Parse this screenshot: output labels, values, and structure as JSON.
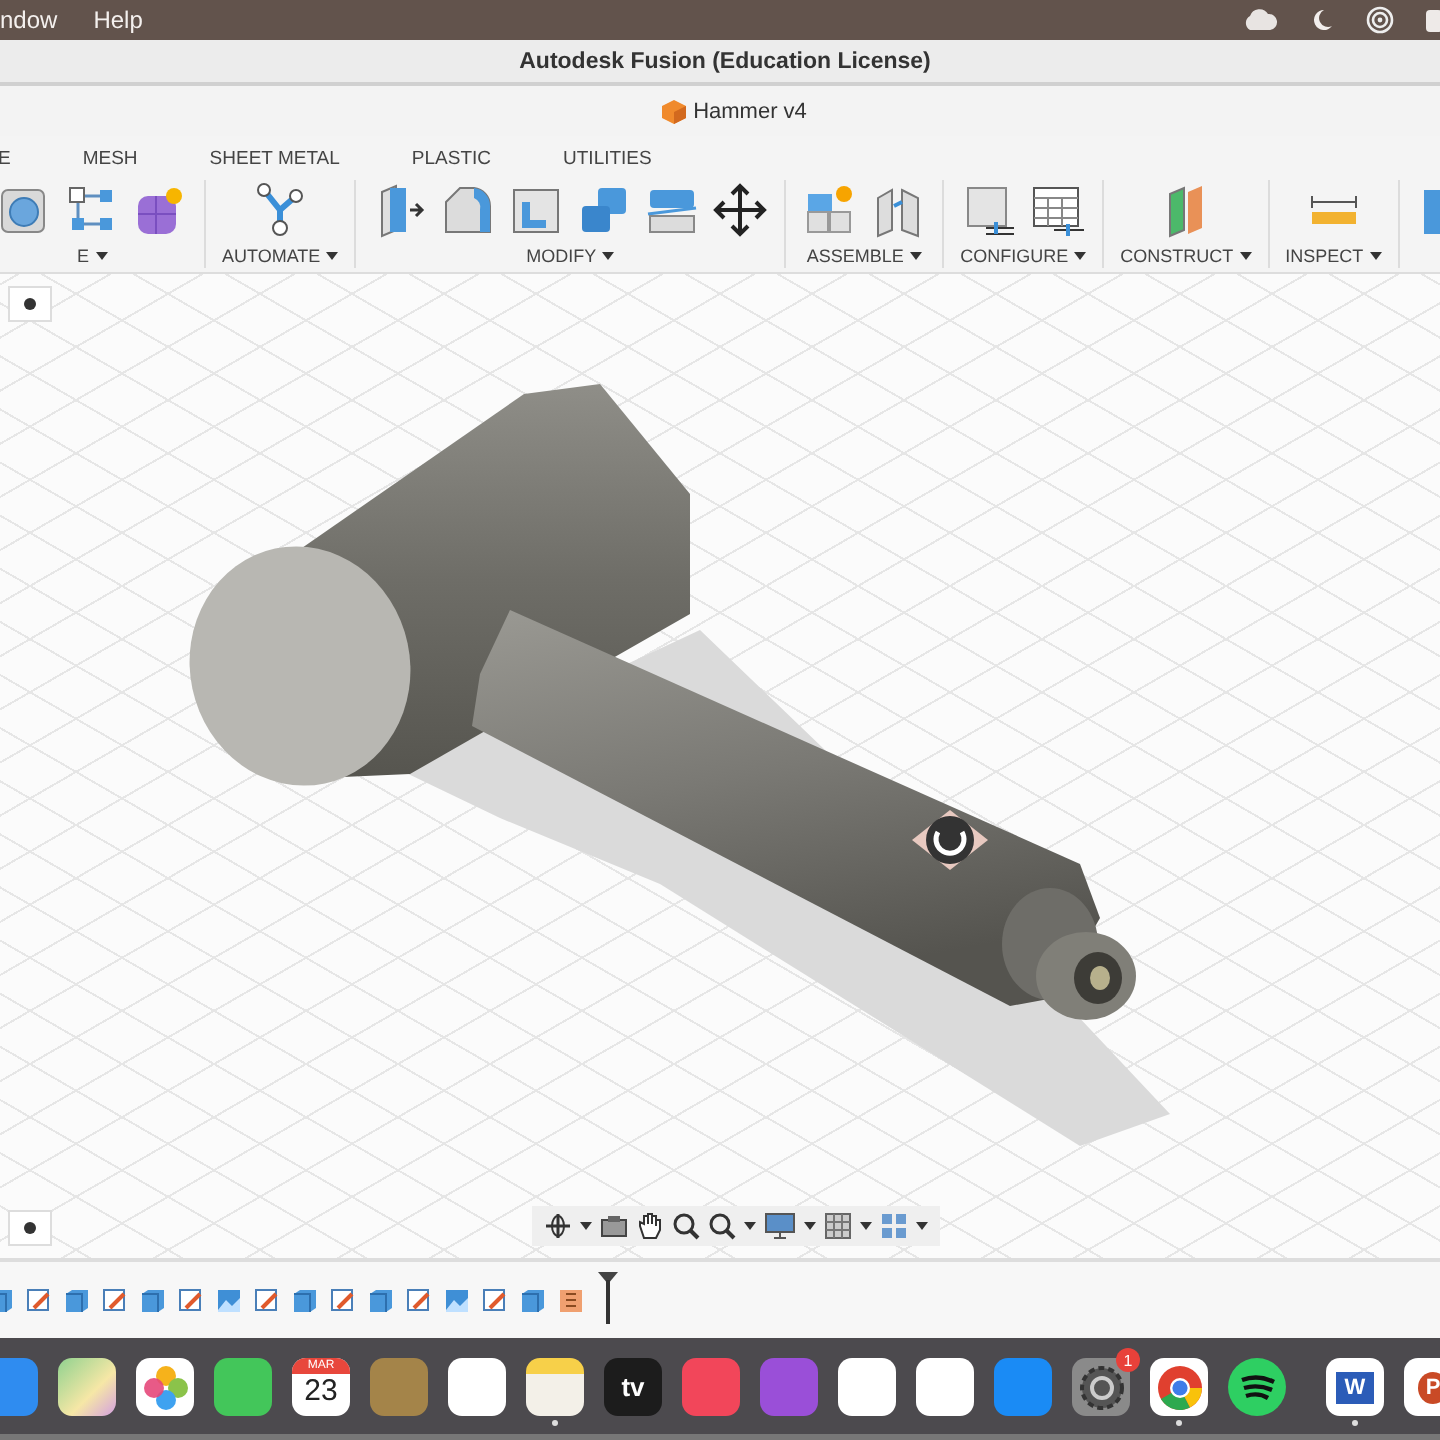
{
  "menu_bar": {
    "items": [
      "ndow",
      "Help"
    ]
  },
  "window": {
    "title": "Autodesk Fusion (Education License)"
  },
  "document_tab": {
    "title": "Hammer v4"
  },
  "toolbar_tabs": [
    {
      "label": "E",
      "selected": false
    },
    {
      "label": "MESH",
      "selected": false
    },
    {
      "label": "SHEET METAL",
      "selected": false
    },
    {
      "label": "PLASTIC",
      "selected": false
    },
    {
      "label": "UTILITIES",
      "selected": false
    }
  ],
  "toolbar_groups": [
    {
      "label": "E",
      "tools": [
        {
          "kind": "sphere-box"
        },
        {
          "kind": "nodes"
        },
        {
          "kind": "sparkle-cube"
        }
      ]
    },
    {
      "label": "AUTOMATE",
      "tools": [
        {
          "kind": "hub"
        }
      ]
    },
    {
      "label": "MODIFY",
      "tools": [
        {
          "kind": "press-pull"
        },
        {
          "kind": "fillet"
        },
        {
          "kind": "shell"
        },
        {
          "kind": "combine"
        },
        {
          "kind": "split"
        },
        {
          "kind": "move"
        }
      ]
    },
    {
      "label": "ASSEMBLE",
      "tools": [
        {
          "kind": "new-component"
        },
        {
          "kind": "joint"
        }
      ]
    },
    {
      "label": "CONFIGURE",
      "tools": [
        {
          "kind": "cube-slider"
        },
        {
          "kind": "table"
        }
      ]
    },
    {
      "label": "CONSTRUCT",
      "tools": [
        {
          "kind": "planes"
        }
      ]
    },
    {
      "label": "INSPECT",
      "tools": [
        {
          "kind": "ruler"
        }
      ]
    },
    {
      "tools": [
        {
          "kind": "cube"
        }
      ]
    }
  ],
  "timeline": [
    {
      "kind": "body"
    },
    {
      "kind": "sketch"
    },
    {
      "kind": "body"
    },
    {
      "kind": "sketch"
    },
    {
      "kind": "body"
    },
    {
      "kind": "sketch"
    },
    {
      "kind": "image"
    },
    {
      "kind": "sketch"
    },
    {
      "kind": "body"
    },
    {
      "kind": "sketch"
    },
    {
      "kind": "body"
    },
    {
      "kind": "sketch"
    },
    {
      "kind": "image"
    },
    {
      "kind": "sketch"
    },
    {
      "kind": "body"
    },
    {
      "kind": "form"
    }
  ],
  "dock": [
    {
      "kind": "finder",
      "running": false
    },
    {
      "kind": "maps",
      "running": false
    },
    {
      "kind": "photos",
      "running": false
    },
    {
      "kind": "facetime",
      "running": false
    },
    {
      "kind": "calendar",
      "month": "MAR",
      "day": "23",
      "running": false
    },
    {
      "kind": "contacts",
      "running": false
    },
    {
      "kind": "reminders",
      "running": false
    },
    {
      "kind": "notes",
      "running": true
    },
    {
      "kind": "tv",
      "text": "tv",
      "running": false
    },
    {
      "kind": "music",
      "running": false
    },
    {
      "kind": "podcasts",
      "running": false
    },
    {
      "kind": "imovie",
      "running": false
    },
    {
      "kind": "news",
      "running": false
    },
    {
      "kind": "appstore",
      "running": false
    },
    {
      "kind": "settings",
      "badge": "1",
      "running": false
    },
    {
      "kind": "chrome",
      "running": true
    },
    {
      "kind": "spotify",
      "running": false
    },
    {
      "kind": "divider"
    },
    {
      "kind": "word",
      "text": "W",
      "running": true
    },
    {
      "kind": "powerpoint",
      "text": "P",
      "running": false
    }
  ]
}
